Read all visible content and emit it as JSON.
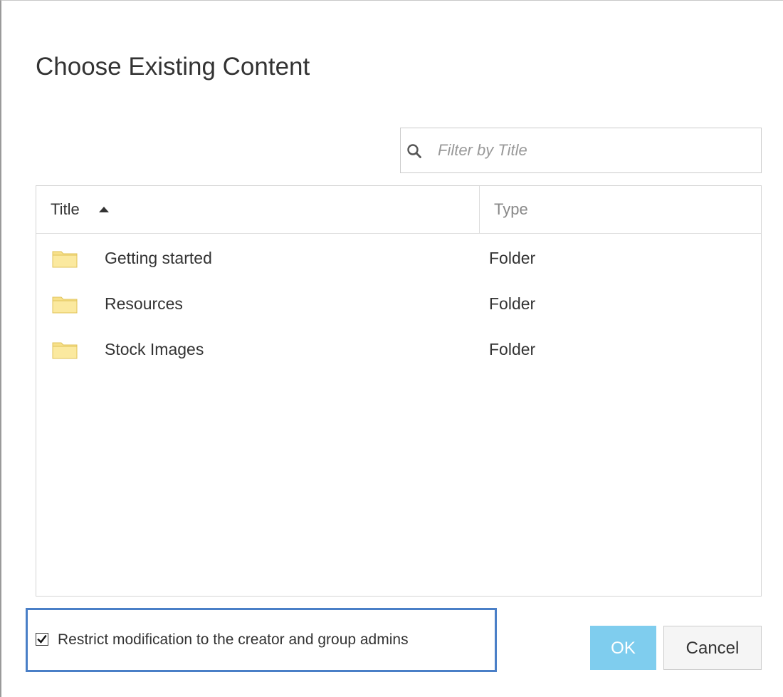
{
  "dialog": {
    "title": "Choose Existing Content"
  },
  "filter": {
    "placeholder": "Filter by Title",
    "value": "",
    "icon": "search-icon"
  },
  "table": {
    "columns": {
      "title": "Title",
      "type": "Type",
      "sort": "ascending"
    },
    "rows": [
      {
        "name": "Getting started",
        "type": "Folder",
        "icon": "folder-icon"
      },
      {
        "name": "Resources",
        "type": "Folder",
        "icon": "folder-icon"
      },
      {
        "name": "Stock Images",
        "type": "Folder",
        "icon": "folder-icon"
      }
    ]
  },
  "restrict": {
    "label": "Restrict modification to the creator and group admins",
    "checked": true
  },
  "buttons": {
    "ok": "OK",
    "cancel": "Cancel"
  },
  "colors": {
    "ok_button": "#7fcdee",
    "highlight_border": "#4a7fc7",
    "folder": "#f7e08a"
  }
}
